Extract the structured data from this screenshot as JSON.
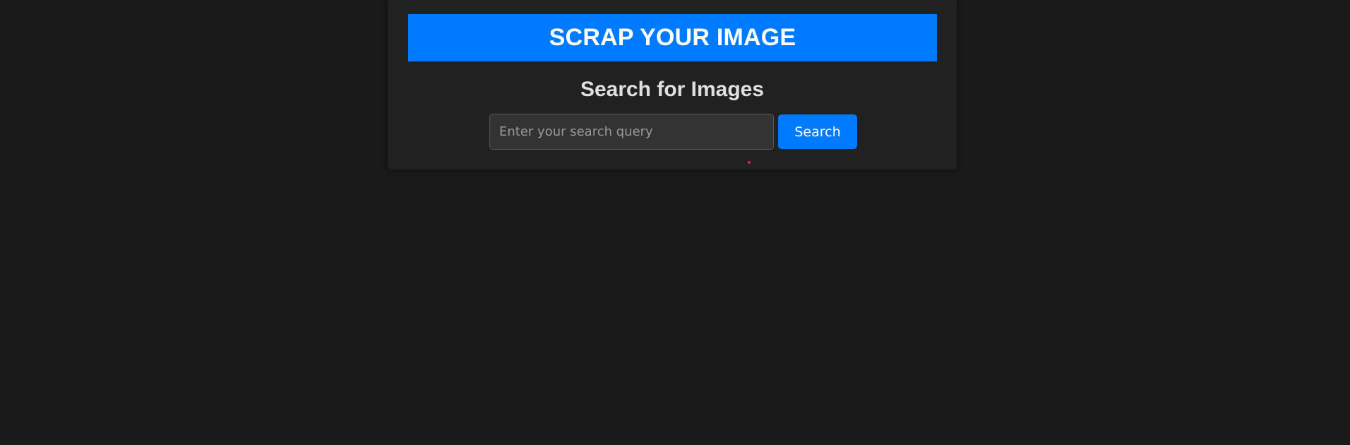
{
  "header": {
    "title": "SCRAP YOUR IMAGE"
  },
  "search": {
    "heading": "Search for Images",
    "placeholder": "Enter your search query",
    "value": "",
    "button_label": "Search"
  },
  "colors": {
    "page_background": "#1a1a1a",
    "card_background": "#212121",
    "accent": "#007bff",
    "status_dot": "#e0242c"
  }
}
